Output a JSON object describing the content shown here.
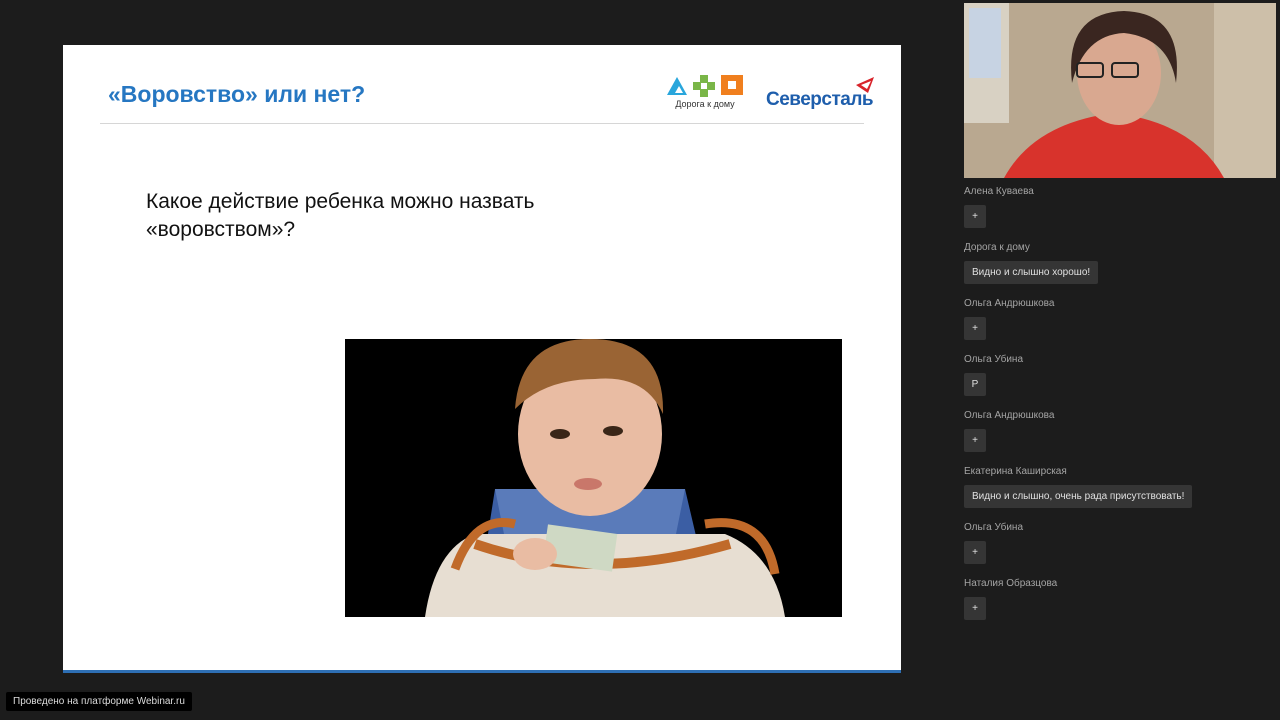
{
  "slide": {
    "title": "«Воровство» или нет?",
    "question": "Какое действие ребенка можно назвать «воровством»?",
    "logos": {
      "doroga_text": "Дорога к дому",
      "severstal_text": "Северсталь"
    },
    "colors": {
      "title": "#2677c2",
      "accent_bar": "#2e6fb4"
    }
  },
  "chat": {
    "messages": [
      {
        "author": "Алена Куваева",
        "text": "+"
      },
      {
        "author": "Дорога к дому",
        "text": "Видно и слышно хорошо!"
      },
      {
        "author": "Ольга Андрюшкова",
        "text": "+"
      },
      {
        "author": "Ольга Убина",
        "text": "Р"
      },
      {
        "author": "Ольга Андрюшкова",
        "text": "+"
      },
      {
        "author": "Екатерина Каширская",
        "text": "Видно и слышно, очень рада присутствовать!"
      },
      {
        "author": "Ольга Убина",
        "text": "+"
      },
      {
        "author": "Наталия Образцова",
        "text": "+"
      }
    ]
  },
  "footer": {
    "platform_label": "Проведено на платформе Webinar.ru"
  }
}
